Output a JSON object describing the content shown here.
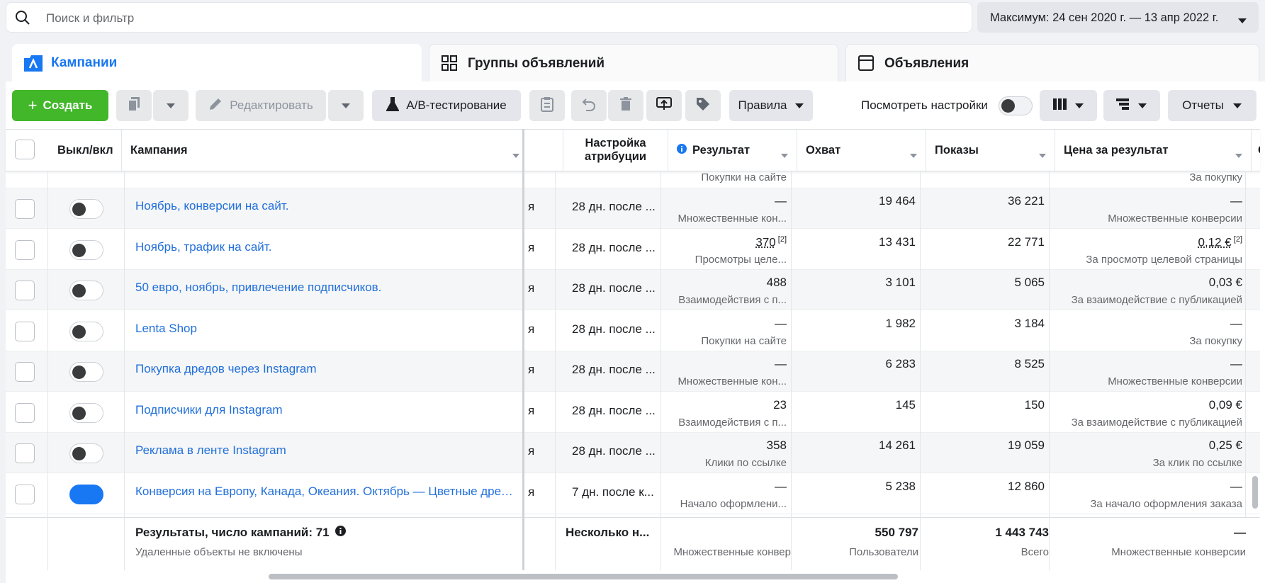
{
  "search": {
    "placeholder": "Поиск и фильтр"
  },
  "date_range": "Максимум: 24 сен 2020 г. — 13 апр 2022 г.",
  "tabs": [
    {
      "label": "Кампании"
    },
    {
      "label": "Группы объявлений"
    },
    {
      "label": "Объявления"
    }
  ],
  "toolbar": {
    "create": "Создать",
    "edit": "Редактировать",
    "ab_test": "A/B-тестирование",
    "rules": "Правила",
    "view_settings": "Посмотреть настройки",
    "reports": "Отчеты"
  },
  "columns": {
    "onoff": "Выкл/вкл",
    "campaign": "Кампания",
    "attribution": "Настройка атрибуции",
    "result": "Результат",
    "reach": "Охват",
    "impressions": "Показы",
    "cost": "Цена за результат",
    "next": "С"
  },
  "partial_row": {
    "result_sub": "Покупки на сайте",
    "cost_sub": "За покупку"
  },
  "rows": [
    {
      "name": "Ноябрь, конверсии на сайт.",
      "on": false,
      "attr": "28 дн. после ...",
      "result": "—",
      "result_sub": "Множественные кон...",
      "reach": "19 464",
      "impr": "36 221",
      "cost": "—",
      "cost_sub": "Множественные конверсии"
    },
    {
      "name": "Ноябрь, трафик на сайт.",
      "on": false,
      "attr": "28 дн. после ...",
      "result": "370",
      "result_note": "[2]",
      "result_sub": "Просмотры целе...",
      "reach": "13 431",
      "impr": "22 771",
      "cost": "0,12 €",
      "cost_note": "[2]",
      "cost_sub": "За просмотр целевой страницы"
    },
    {
      "name": "50 евро, ноябрь, привлечение подписчиков.",
      "on": false,
      "attr": "28 дн. после ...",
      "result": "488",
      "result_sub": "Взаимодействия с п...",
      "reach": "3 101",
      "impr": "5 065",
      "cost": "0,03 €",
      "cost_sub": "За взаимодействие с публикацией"
    },
    {
      "name": "Lenta Shop",
      "on": false,
      "attr": "28 дн. после ...",
      "result": "—",
      "result_sub": "Покупки на сайте",
      "reach": "1 982",
      "impr": "3 184",
      "cost": "—",
      "cost_sub": "За покупку"
    },
    {
      "name": "Покупка дредов через Instagram",
      "on": false,
      "attr": "28 дн. после ...",
      "result": "—",
      "result_sub": "Множественные кон...",
      "reach": "6 283",
      "impr": "8 525",
      "cost": "—",
      "cost_sub": "Множественные конверсии"
    },
    {
      "name": "Подписчики для Instagram",
      "on": false,
      "attr": "28 дн. после ...",
      "result": "23",
      "result_sub": "Взаимодействия с п...",
      "reach": "145",
      "impr": "150",
      "cost": "0,09 €",
      "cost_sub": "За взаимодействие с публикацией"
    },
    {
      "name": "Реклама в ленте Instagram",
      "on": false,
      "attr": "28 дн. после ...",
      "result": "358",
      "result_sub": "Клики по ссылке",
      "reach": "14 261",
      "impr": "19 059",
      "cost": "0,25 €",
      "cost_sub": "За клик по ссылке"
    },
    {
      "name": "Конверсия на Европу, Канада, Океания. Октябрь — Цветные дреды",
      "on": true,
      "attr": "7 дн. после к...",
      "result": "—",
      "result_sub": "Начало оформлени...",
      "reach": "5 238",
      "impr": "12 860",
      "cost": "—",
      "cost_sub": "За начало оформления заказа"
    }
  ],
  "frag": "я",
  "footer": {
    "title": "Результаты, число кампаний: 71",
    "note": "Удаленные объекты не включены",
    "attr": "Несколько н...",
    "result_sub": "Множественные конвер",
    "reach": "550 797",
    "reach_sub": "Пользователи",
    "impr": "1 443 743",
    "impr_sub": "Всего",
    "cost": "—",
    "cost_sub": "Множественные конверсии"
  }
}
